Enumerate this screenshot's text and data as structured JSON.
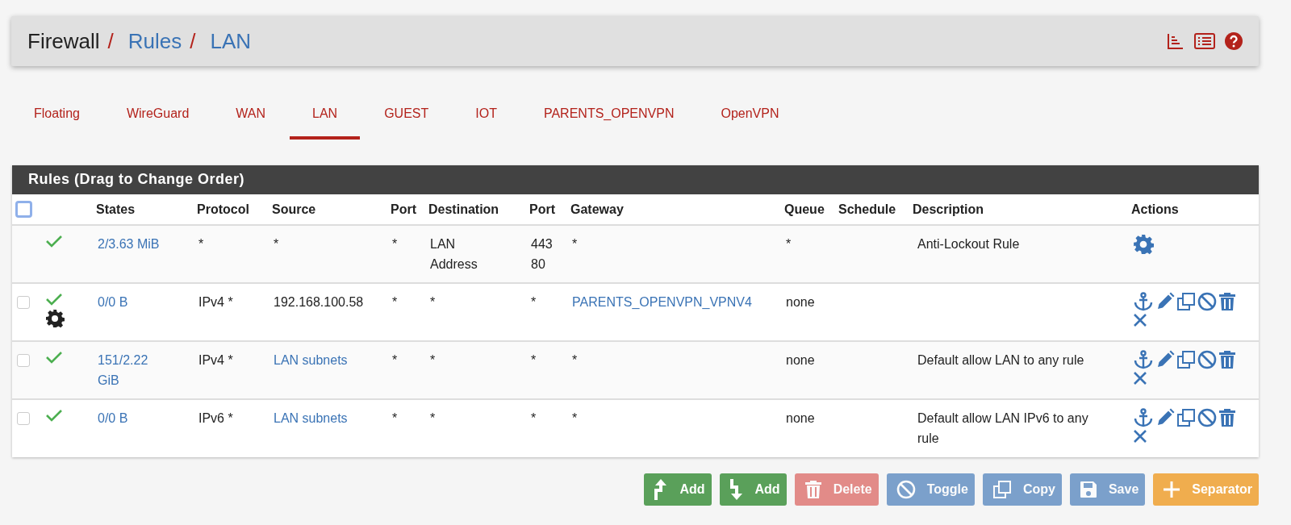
{
  "breadcrumb": {
    "separator": "/",
    "items": [
      {
        "label": "Firewall",
        "link": false
      },
      {
        "label": "Rules",
        "link": true
      },
      {
        "label": "LAN",
        "link": true
      }
    ]
  },
  "tabs": [
    {
      "label": "Floating",
      "selected": false
    },
    {
      "label": "WireGuard",
      "selected": false
    },
    {
      "label": "WAN",
      "selected": false
    },
    {
      "label": "LAN",
      "selected": true
    },
    {
      "label": "GUEST",
      "selected": false
    },
    {
      "label": "IOT",
      "selected": false
    },
    {
      "label": "PARENTS_OPENVPN",
      "selected": false
    },
    {
      "label": "OpenVPN",
      "selected": false
    }
  ],
  "panel": {
    "title": "Rules (Drag to Change Order)",
    "select_all": {
      "checked": false
    },
    "columns": [
      "States",
      "Protocol",
      "Source",
      "Port",
      "Destination",
      "Port",
      "Gateway",
      "Queue",
      "Schedule",
      "Description",
      "Actions"
    ],
    "rows": [
      {
        "kind": "locked",
        "selectable": false,
        "enabled": true,
        "advanced": false,
        "states": "2/3.63 MiB",
        "protocol": "*",
        "source": "*",
        "source_link": false,
        "source_port": "*",
        "destination": "LAN Address",
        "destination_port": "443\n80",
        "gateway": "*",
        "gateway_link": false,
        "queue": "*",
        "description": "Anti-Lockout Rule"
      },
      {
        "kind": "editable",
        "selectable": true,
        "checked": false,
        "enabled": true,
        "advanced": true,
        "states": "0/0 B",
        "protocol": "IPv4 *",
        "source": "192.168.100.58",
        "source_link": false,
        "source_port": "*",
        "destination": "*",
        "destination_port": "*",
        "gateway": "PARENTS_OPENVPN_VPNV4",
        "gateway_link": true,
        "queue": "none"
      },
      {
        "kind": "editable",
        "selectable": true,
        "checked": false,
        "enabled": true,
        "advanced": false,
        "states": "151/2.22 GiB",
        "protocol": "IPv4 *",
        "source": "LAN subnets",
        "source_link": true,
        "source_port": "*",
        "destination": "*",
        "destination_port": "*",
        "gateway": "*",
        "gateway_link": false,
        "queue": "none",
        "description": "Default allow LAN to any rule"
      },
      {
        "kind": "editable",
        "selectable": true,
        "checked": false,
        "enabled": true,
        "advanced": false,
        "states": "0/0 B",
        "protocol": "IPv6 *",
        "source": "LAN subnets",
        "source_link": true,
        "source_port": "*",
        "destination": "*",
        "destination_port": "*",
        "gateway": "*",
        "gateway_link": false,
        "queue": "none",
        "description": "Default allow LAN IPv6 to any rule"
      }
    ]
  },
  "buttons": [
    {
      "kind": "add_top",
      "label": "Add",
      "disabled": false
    },
    {
      "kind": "add_bottom",
      "label": "Add",
      "disabled": false
    },
    {
      "kind": "delete",
      "label": "Delete",
      "disabled": true
    },
    {
      "kind": "toggle",
      "label": "Toggle",
      "disabled": true
    },
    {
      "kind": "copy",
      "label": "Copy",
      "disabled": true
    },
    {
      "kind": "save",
      "label": "Save",
      "disabled": true
    },
    {
      "kind": "separator",
      "label": "Separator",
      "disabled": false
    }
  ]
}
